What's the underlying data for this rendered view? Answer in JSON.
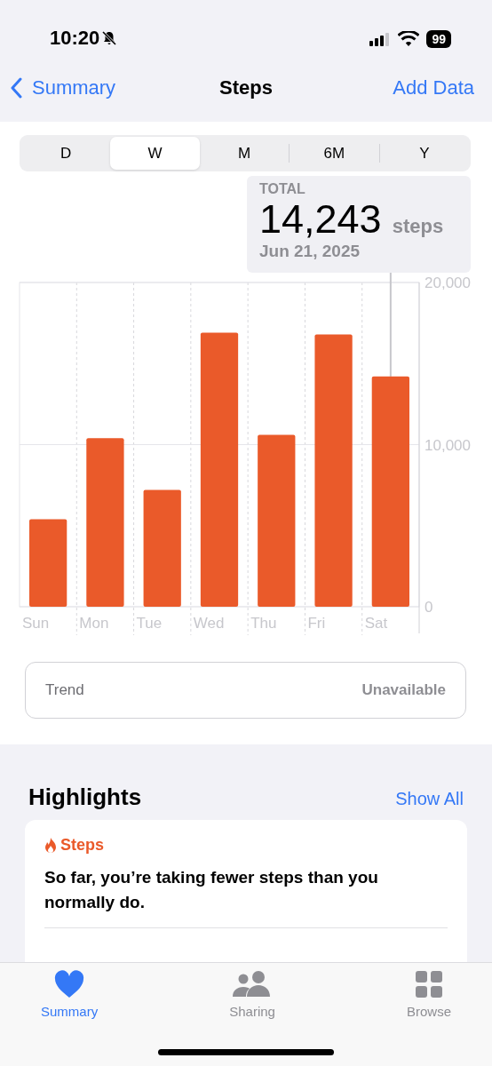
{
  "status_bar": {
    "time": "10:20",
    "silent": true,
    "battery": "99"
  },
  "nav": {
    "back": "Summary",
    "title": "Steps",
    "action": "Add Data"
  },
  "ranges": [
    {
      "label": "D",
      "selected": false
    },
    {
      "label": "W",
      "selected": true
    },
    {
      "label": "M",
      "selected": false
    },
    {
      "label": "6M",
      "selected": false
    },
    {
      "label": "Y",
      "selected": false
    }
  ],
  "callout": {
    "label": "TOTAL",
    "value": "14,243",
    "unit": "steps",
    "date": "Jun 21, 2025"
  },
  "chart_data": {
    "type": "bar",
    "categories": [
      "Sun",
      "Mon",
      "Tue",
      "Wed",
      "Thu",
      "Fri",
      "Sat"
    ],
    "series": [
      {
        "color": "#ea5a2a",
        "values": [
          5400,
          10400,
          7200,
          16900,
          10600,
          16800,
          14200
        ]
      }
    ],
    "ylim": [
      0,
      20000
    ],
    "yticks": [
      {
        "value": 0,
        "label": "0"
      },
      {
        "value": 10000,
        "label": "10,000"
      },
      {
        "value": 20000,
        "label": "20,000"
      }
    ]
  },
  "trend": {
    "label": "Trend",
    "value": "Unavailable"
  },
  "highlights": {
    "title": "Highlights",
    "link": "Show All",
    "card": {
      "category": "Steps",
      "text": "So far, you’re taking fewer steps than you normally do."
    }
  },
  "tab_bar": [
    {
      "label": "Summary",
      "kind": "heart",
      "selected": true
    },
    {
      "label": "Sharing",
      "kind": "people",
      "selected": false
    },
    {
      "label": "Browse",
      "kind": "grid",
      "selected": false
    }
  ]
}
